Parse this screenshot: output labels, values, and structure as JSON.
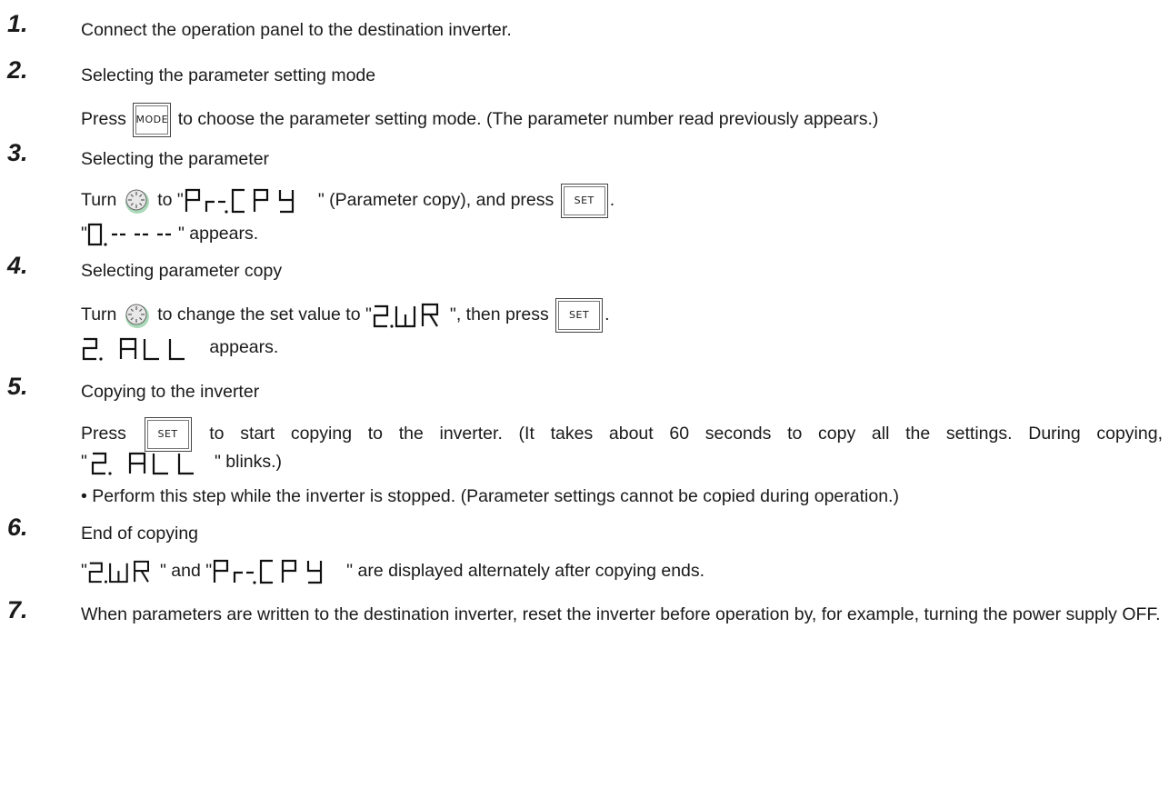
{
  "steps": [
    {
      "number": "1.",
      "title": "Connect the operation panel to the destination inverter."
    },
    {
      "number": "2.",
      "title": "Selecting the parameter setting mode",
      "body_pre": "Press",
      "key": "MODE",
      "body_post": "to choose the parameter setting mode. (The parameter number read previously appears.)"
    },
    {
      "number": "3.",
      "title": "Selecting the parameter",
      "line1": {
        "pre": "Turn",
        "mid": "to \"",
        "display": "Pr.CPY",
        "post": "\" (Parameter copy), and press",
        "key": "SET",
        "end": "."
      },
      "line2": {
        "open": "\"",
        "display": "0.-- -- --",
        "post": "\" appears."
      }
    },
    {
      "number": "4.",
      "title": "Selecting parameter copy",
      "line1": {
        "pre": "Turn",
        "mid": "to change the set value to \"",
        "display": "2.WR",
        "post": "\", then press",
        "key": "SET",
        "end": "."
      },
      "line2": {
        "display": "2. ALL",
        "post": "appears."
      }
    },
    {
      "number": "5.",
      "title": "Copying to the inverter",
      "line1": {
        "pre": "Press",
        "key": "SET",
        "post": "to start copying to the inverter. (It takes about 60 seconds to copy all the settings. During copying,"
      },
      "line2": {
        "open": "\"",
        "display": "2. ALL",
        "post": "\" blinks.)"
      },
      "note": "• Perform this step while the inverter is stopped. (Parameter settings cannot be copied during operation.)"
    },
    {
      "number": "6.",
      "title": "End of copying",
      "line1": {
        "open": "\"",
        "display_a": "2.WR",
        "mid": "\" and \"",
        "display_b": "Pr.CPY",
        "post": "\" are displayed alternately after copying ends."
      }
    },
    {
      "number": "7.",
      "title": "When parameters are written to the destination inverter, reset the inverter before operation by, for example, turning the power supply OFF."
    }
  ]
}
